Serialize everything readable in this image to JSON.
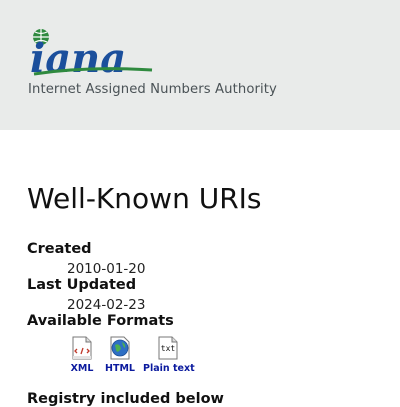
{
  "header": {
    "logo_text": "iana",
    "tagline": "Internet Assigned Numbers Authority"
  },
  "main": {
    "title": "Well-Known URIs",
    "created_label": "Created",
    "created_value": "2010-01-20",
    "updated_label": "Last Updated",
    "updated_value": "2024-02-23",
    "formats_label": "Available Formats",
    "formats": [
      {
        "label": "XML",
        "icon": "xml-file-icon"
      },
      {
        "label": "HTML",
        "icon": "globe-icon"
      },
      {
        "label": "Plain text",
        "icon": "txt-file-icon",
        "icon_text": "txt"
      }
    ],
    "registry_label": "Registry included below"
  },
  "colors": {
    "header_bg": "#e9ebea",
    "link": "#0b1a9e",
    "logo_blue": "#1b4f9c",
    "logo_green": "#2f8a3f"
  }
}
